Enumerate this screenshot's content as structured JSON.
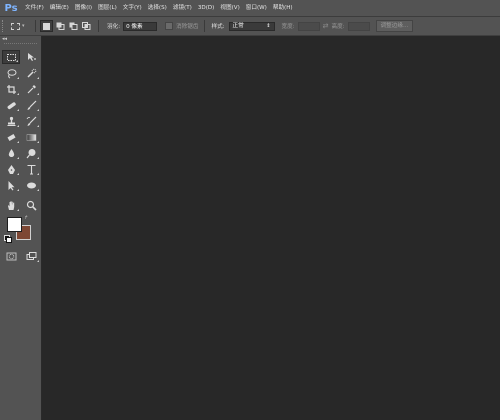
{
  "app": {
    "logo": "Ps"
  },
  "menu": [
    {
      "label": "文件(F)"
    },
    {
      "label": "编辑(E)"
    },
    {
      "label": "图像(I)"
    },
    {
      "label": "图层(L)"
    },
    {
      "label": "文字(Y)"
    },
    {
      "label": "选择(S)"
    },
    {
      "label": "滤镜(T)"
    },
    {
      "label": "3D(D)"
    },
    {
      "label": "视图(V)"
    },
    {
      "label": "窗口(W)"
    },
    {
      "label": "帮助(H)"
    }
  ],
  "options": {
    "feather_label": "羽化:",
    "feather_value": "0 像素",
    "antialias_label": "消除锯齿",
    "style_label": "样式:",
    "style_value": "正常",
    "width_label": "宽度:",
    "height_label": "高度:",
    "refine_edge_label": "调整边缘..."
  },
  "toolbar": {
    "header": "◂◂",
    "tools": [
      [
        "rectangular-marquee-icon",
        "move-icon"
      ],
      [
        "lasso-icon",
        "quick-selection-icon"
      ],
      [
        "crop-icon",
        "eyedropper-icon"
      ],
      [
        "spot-healing-icon",
        "brush-icon"
      ],
      [
        "clone-stamp-icon",
        "history-brush-icon"
      ],
      [
        "eraser-icon",
        "gradient-icon"
      ],
      [
        "blur-icon",
        "dodge-icon"
      ],
      [
        "pen-icon",
        "type-icon"
      ],
      [
        "path-selection-icon",
        "ellipse-icon"
      ],
      [
        "hand-icon",
        "zoom-icon"
      ]
    ]
  },
  "colors": {
    "foreground": "#ffffff",
    "background": "#7d4734",
    "canvas": "#282828",
    "chrome": "#535353",
    "logo": "#7fb5ff"
  }
}
